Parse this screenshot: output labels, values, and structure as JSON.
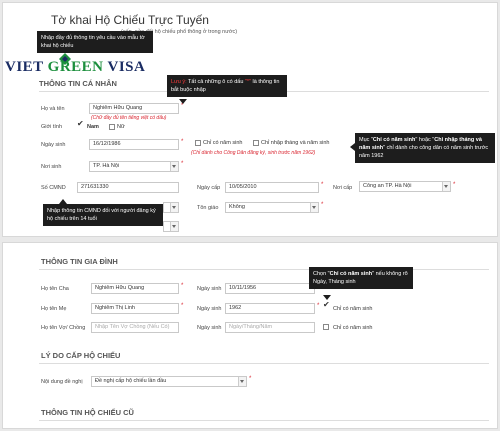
{
  "brand": {
    "left": "VIET ",
    "mid": "GREEN",
    "right": " VISA"
  },
  "header": {
    "title": "Tờ khai Hộ Chiếu Trực Tuyến",
    "subtitle": "(cấp, sửa đổi hộ chiếu phổ thông ở trong nước)"
  },
  "tooltips": {
    "required_fields": "Nhập đầy đủ thông tin yêu cầu vào mẫu tờ khai hộ chiếu",
    "note_prefix": "Lưu ý:",
    "note_text": " Tất cả những ô có dấu ",
    "note_star": "\"*\"",
    "note_suffix": " là thông tin bắt buộc nhập",
    "birth_year_prefix": "Mục \"",
    "birth_year_b1": "Chỉ có năm sinh",
    "birth_year_mid": "\" hoặc \"",
    "birth_year_b2": "Chỉ nhập tháng và năm sinh",
    "birth_year_suffix": "\" chỉ dành cho công dân có năm sinh trước năm 1962",
    "cmnd_prefix": "Nhập thông tin CMND đối với người đăng ký hộ chiếu trên 14 tuổi",
    "parent_prefix": "Chọn \"",
    "parent_b": "Chỉ có năm sinh",
    "parent_suffix": "\" nếu không rõ Ngày, Tháng sinh"
  },
  "personal": {
    "section_title": "THÔNG TIN CÁ NHÂN",
    "name_label": "Họ và tên",
    "name_value": "Nghiêm Hữu Quang",
    "name_note": "(Chữ đầy đủ tên tiếng việt có dấu)",
    "gender_label": "Giới tính",
    "gender_male": "Nam",
    "gender_female": "Nữ",
    "dob_label": "Ngày sinh",
    "dob_value": "16/12/1986",
    "only_year_label": "Chỉ có năm sinh",
    "month_year_label": "Chỉ nhập tháng và năm sinh",
    "dob_note": "(Chỉ dành cho Công Dân đăng ký, sinh trước năm 1962)",
    "birthplace_label": "Nơi sinh",
    "birthplace_value": "TP. Hà Nội",
    "cmnd_label": "Số CMND",
    "cmnd_value": "271631330",
    "issue_date_label": "Ngày cấp",
    "issue_date_value": "10/05/2010",
    "issue_place_label": "Nơi cấp",
    "issue_place_value": "Công an TP. Hà Nội",
    "religion_label": "Tôn giáo",
    "religion_value": "Không",
    "required_mark": "*"
  },
  "family": {
    "section_title": "THÔNG TIN GIA ĐÌNH",
    "father_label": "Họ tên Cha",
    "father_value": "Nghiêm Hữu Quang",
    "father_dob_label": "Ngày sinh",
    "father_dob_value": "10/11/1956",
    "mother_label": "Họ tên Mẹ",
    "mother_value": "Nghiêm Thị Linh",
    "mother_dob_label": "Ngày sinh",
    "mother_dob_value": "1962",
    "only_year_label": "Chỉ có năm sinh",
    "spouse_label": "Họ tên Vợ/ Chồng",
    "spouse_placeholder": "Nhập Tên Vợ Chồng (Nếu Có)",
    "spouse_dob_label": "Ngày sinh",
    "spouse_dob_placeholder": "Ngày/Tháng/Năm",
    "required_mark": "*"
  },
  "reason": {
    "section_title": "LÝ DO CẤP HỘ CHIẾU",
    "request_label": "Nội dung đề nghị",
    "request_value": "Đề nghị cấp hộ chiếu lần đầu",
    "required_mark": "*"
  },
  "old_passport": {
    "section_title": "THÔNG TIN HỘ CHIẾU CŨ"
  },
  "colors": {
    "tooltip_bg": "#1d1d1d",
    "required_red": "#d9232e",
    "brand_navy": "#1a2c63",
    "brand_green": "#1c8f3d"
  }
}
